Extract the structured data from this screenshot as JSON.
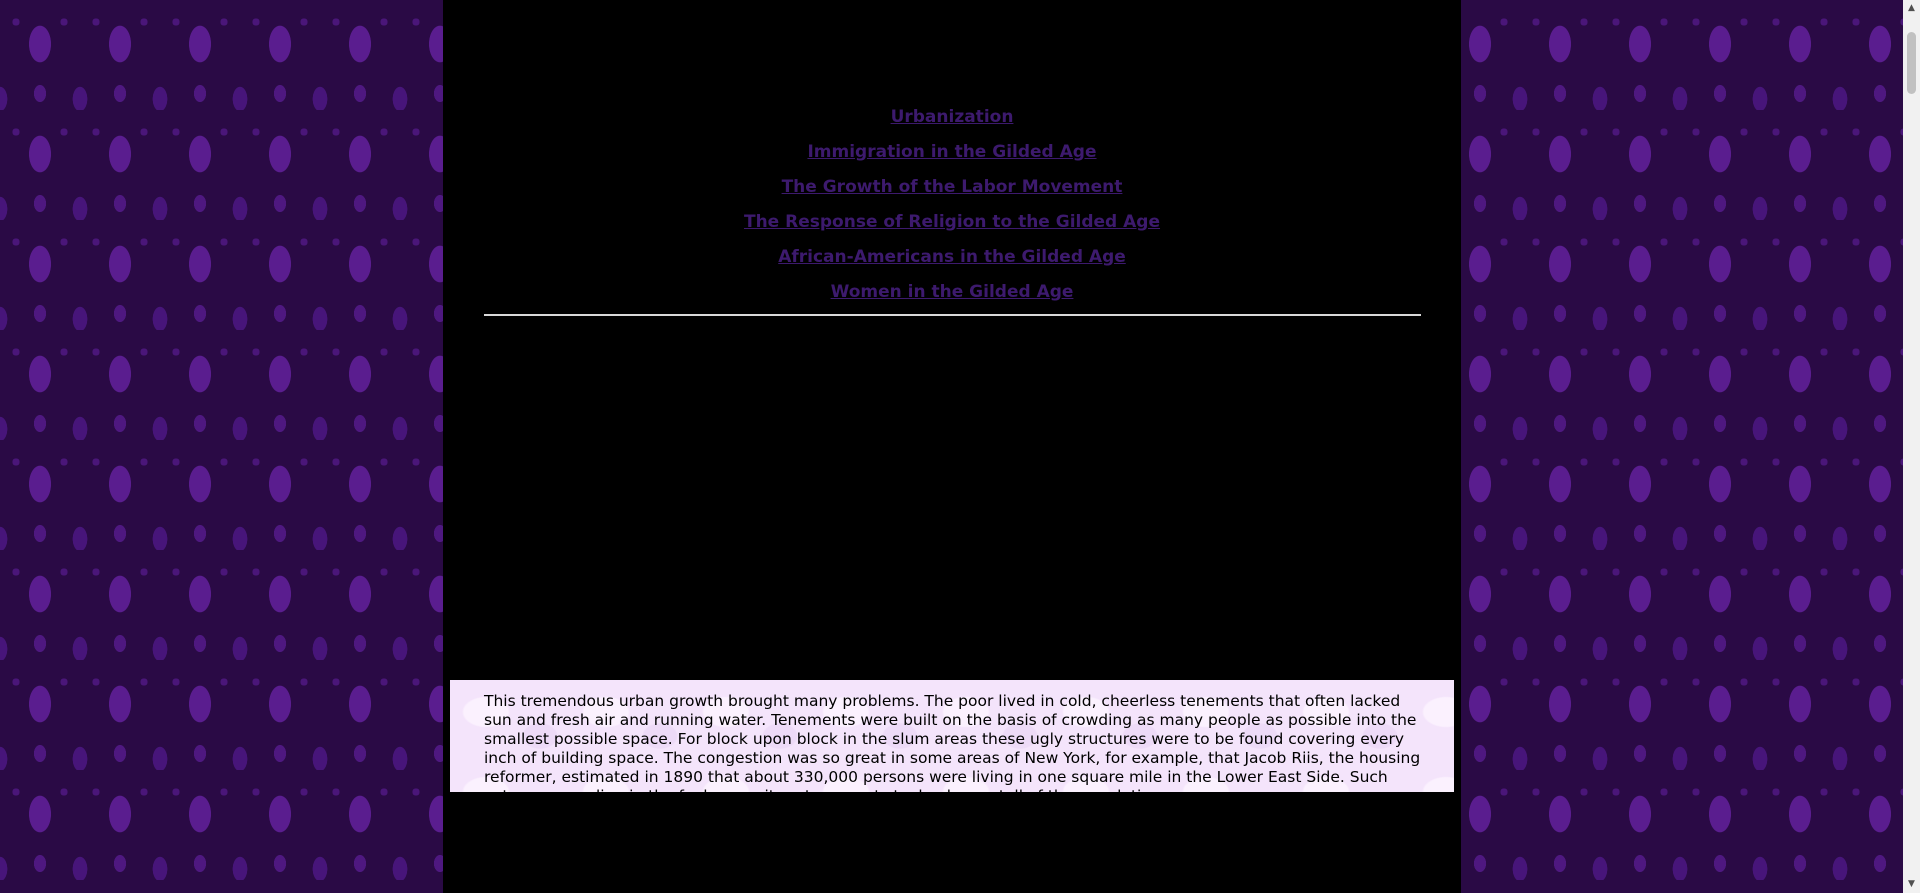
{
  "nav_links": [
    "Urbanization",
    "Immigration in the Gilded Age",
    "The Growth of the Labor Movement",
    "The Response of Religion to the Gilded Age",
    "African-Americans in the Gilded Age",
    "Women in the Gilded Age"
  ],
  "content": {
    "paragraph": "This tremendous urban growth brought many problems. The poor lived in cold, cheerless tenements that often lacked sun and fresh air and running water. Tenements were built on the basis of crowding as many people as possible into the smallest possible space. For block upon block in the slum areas these ugly structures were to be found covering every inch of building space. The congestion was so great in some areas of New York, for example, that Jacob Riis, the housing reformer, estimated in 1890 that about 330,000 persons were living in one square mile in the Lower East Side. Such extreme crowding in the foul, unsanitary tenements took a heavy toll of the population."
  },
  "scrollbar": {
    "up_icon": "triangle-up",
    "down_icon": "triangle-down"
  },
  "colors": {
    "link": "#3d1a6e",
    "page_background": "#000000",
    "text_box_background": "#f4e4fb",
    "wallpaper": "#2a0a45"
  }
}
